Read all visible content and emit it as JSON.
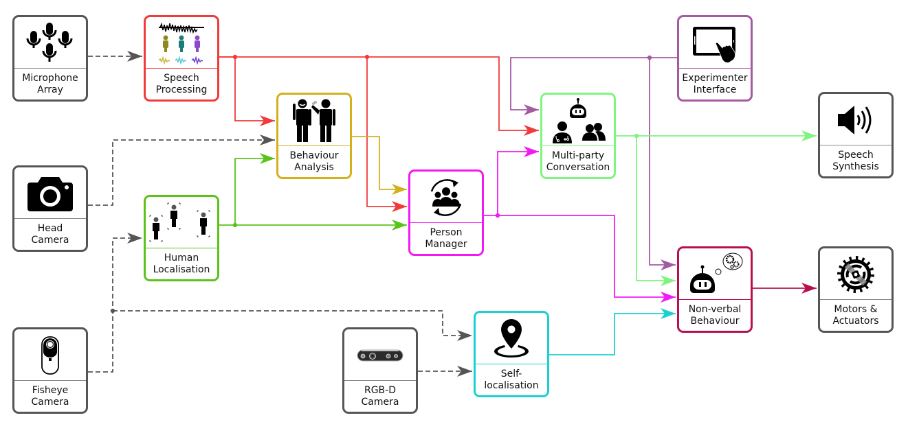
{
  "diagram": {
    "type": "architecture-block-diagram",
    "colors": {
      "sensor": "#555555",
      "speech_processing": "#f23a3a",
      "behaviour_analysis": "#d4b01a",
      "human_localisation": "#5bc21a",
      "person_manager": "#f21af2",
      "multi_party_conversation": "#7ef57e",
      "experimenter_interface": "#a45aa0",
      "non_verbal_behaviour": "#b8104f",
      "self_localisation": "#1ad0d0",
      "dashed_wire": "#555555"
    },
    "nodes": {
      "microphone_array": {
        "label": "Microphone\nArray",
        "icon": "microphone-array-icon"
      },
      "speech_processing": {
        "label": "Speech\nProcessing",
        "icon": "speech-waveform-speakers-icon"
      },
      "head_camera": {
        "label": "Head\nCamera",
        "icon": "camera-icon"
      },
      "behaviour_analysis": {
        "label": "Behaviour\nAnalysis",
        "icon": "two-people-talking-icon"
      },
      "human_localisation": {
        "label": "Human\nLocalisation",
        "icon": "people-detection-icon"
      },
      "person_manager": {
        "label": "Person\nManager",
        "icon": "group-cycle-icon"
      },
      "multi_party_conversation": {
        "label": "Multi-party\nConversation",
        "icon": "robot-doctor-group-icon"
      },
      "experimenter_interface": {
        "label": "Experimenter\nInterface",
        "icon": "tablet-touch-icon"
      },
      "speech_synthesis": {
        "label": "Speech\nSynthesis",
        "icon": "speaker-icon"
      },
      "non_verbal_behaviour": {
        "label": "Non-verbal\nBehaviour",
        "icon": "robot-thinking-icon"
      },
      "motors_actuators": {
        "label": "Motors &\nActuators",
        "icon": "motor-gear-icon"
      },
      "fisheye_camera": {
        "label": "Fisheye\nCamera",
        "icon": "fisheye-camera-icon"
      },
      "rgbd_camera": {
        "label": "RGB-D\nCamera",
        "icon": "rgbd-camera-icon"
      },
      "self_localisation": {
        "label": "Self-\nlocalisation",
        "icon": "location-pin-icon"
      }
    },
    "edges": [
      {
        "from": "microphone_array",
        "to": "speech_processing",
        "style": "dashed"
      },
      {
        "from": "speech_processing",
        "to": "behaviour_analysis",
        "style": "solid"
      },
      {
        "from": "speech_processing",
        "to": "person_manager",
        "style": "solid"
      },
      {
        "from": "speech_processing",
        "to": "multi_party_conversation",
        "style": "solid"
      },
      {
        "from": "head_camera",
        "to": "behaviour_analysis",
        "style": "dashed"
      },
      {
        "from": "head_camera",
        "to": "human_localisation",
        "style": "dashed"
      },
      {
        "from": "fisheye_camera",
        "to": "human_localisation",
        "style": "dashed"
      },
      {
        "from": "fisheye_camera",
        "to": "self_localisation",
        "style": "dashed"
      },
      {
        "from": "rgbd_camera",
        "to": "self_localisation",
        "style": "dashed"
      },
      {
        "from": "human_localisation",
        "to": "behaviour_analysis",
        "style": "solid"
      },
      {
        "from": "human_localisation",
        "to": "person_manager",
        "style": "solid"
      },
      {
        "from": "behaviour_analysis",
        "to": "person_manager",
        "style": "solid"
      },
      {
        "from": "person_manager",
        "to": "multi_party_conversation",
        "style": "solid"
      },
      {
        "from": "person_manager",
        "to": "non_verbal_behaviour",
        "style": "solid"
      },
      {
        "from": "experimenter_interface",
        "to": "multi_party_conversation",
        "style": "solid"
      },
      {
        "from": "experimenter_interface",
        "to": "non_verbal_behaviour",
        "style": "solid"
      },
      {
        "from": "multi_party_conversation",
        "to": "speech_synthesis",
        "style": "solid"
      },
      {
        "from": "multi_party_conversation",
        "to": "non_verbal_behaviour",
        "style": "solid"
      },
      {
        "from": "self_localisation",
        "to": "non_verbal_behaviour",
        "style": "solid"
      },
      {
        "from": "non_verbal_behaviour",
        "to": "motors_actuators",
        "style": "solid"
      }
    ]
  }
}
